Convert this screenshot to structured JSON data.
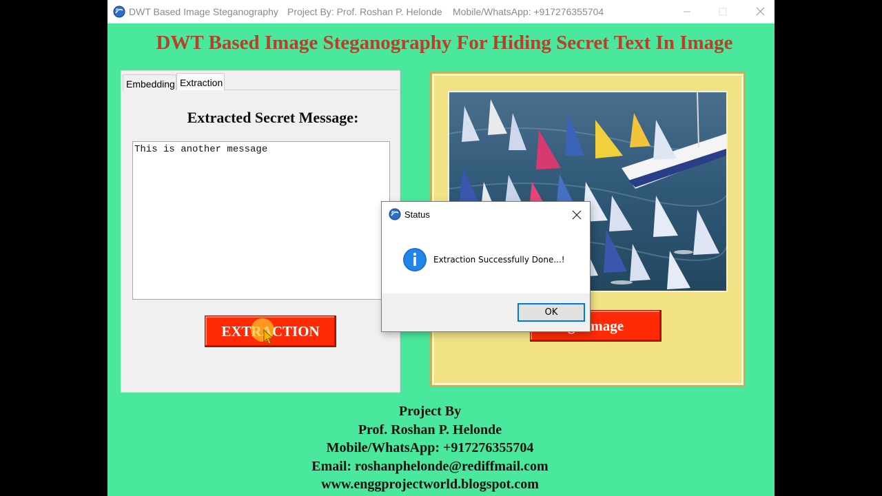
{
  "window": {
    "title": "DWT Based Image Steganography",
    "project_by": "Project By: Prof. Roshan P. Helonde",
    "mobile": "Mobile/WhatsApp: +917276355704"
  },
  "heading": "DWT Based Image Steganography For Hiding Secret Text In Image",
  "tabs": [
    {
      "label": "Embedding"
    },
    {
      "label": "Extraction"
    }
  ],
  "extraction": {
    "label": "Extracted Secret Message:",
    "message": "This is another message",
    "button_label": "EXTRACTION"
  },
  "image_panel": {
    "button_label": "ge Image"
  },
  "footer": {
    "line1": "Project By",
    "line2": "Prof. Roshan P. Helonde",
    "line3": "Mobile/WhatsApp: +917276355704",
    "line4": "Email: roshanphelonde@rediffmail.com",
    "line5": "www.enggprojectworld.blogspot.com"
  },
  "dialog": {
    "title": "Status",
    "message": "Extraction Successfully Done...!",
    "ok_label": "OK"
  },
  "colors": {
    "background": "#4ae89c",
    "heading": "#b8402a",
    "button": "#fe2b06",
    "frame": "#f2e286",
    "focus": "#0078d7"
  }
}
